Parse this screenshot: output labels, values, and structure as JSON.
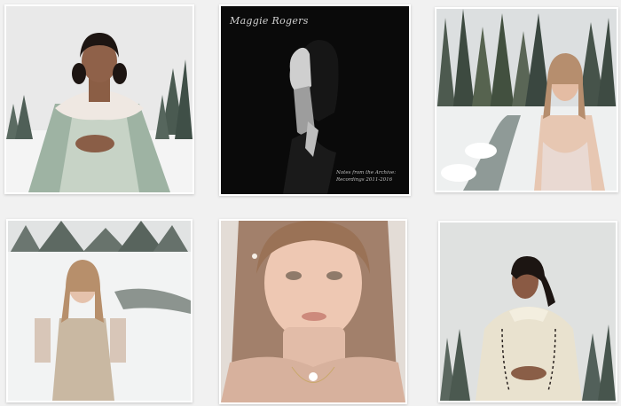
{
  "feed": {
    "posts": [
      {
        "alt": "woman-in-sequin-cape-snow"
      },
      {
        "alt": "album-cover",
        "script_title": "Maggie Rogers",
        "caption_line1": "Notes from the Archive:",
        "caption_line2": "Recordings 2011-2016"
      },
      {
        "alt": "woman-by-snowy-stream"
      },
      {
        "alt": "girl-in-sheer-dress-snow"
      },
      {
        "alt": "portrait-pink-turtleneck"
      },
      {
        "alt": "woman-in-ruffle-blouse"
      }
    ]
  },
  "colors": {
    "page_bg": "#f1f1f1",
    "tile_bg": "#ffffff",
    "album_bg": "#0a0a0a"
  }
}
